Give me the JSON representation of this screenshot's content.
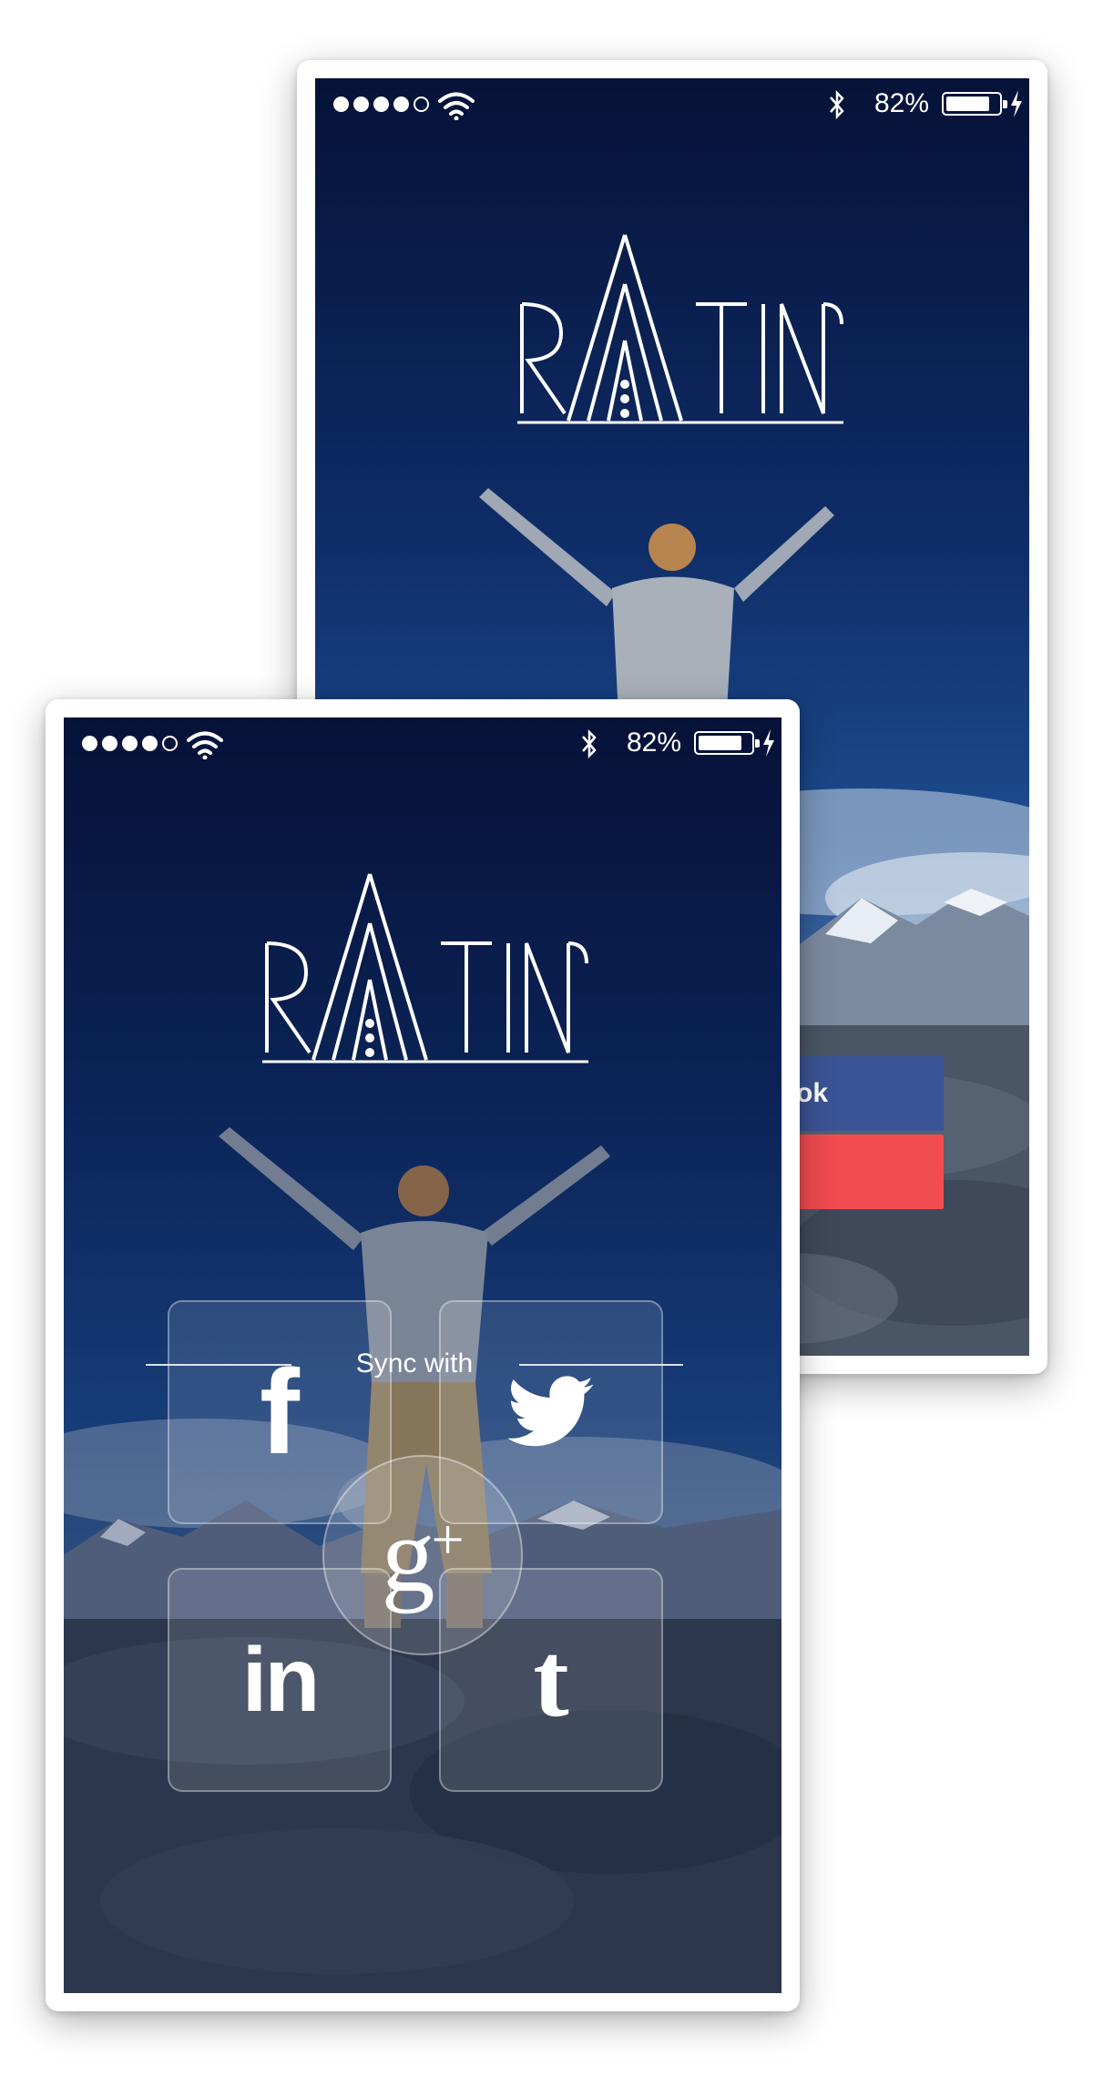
{
  "status_bar": {
    "signal_dots_filled": 4,
    "signal_dots_total": 5,
    "battery_text": "82%",
    "battery_level_pct": 82
  },
  "logo": {
    "text": "RATING"
  },
  "back_screen": {
    "buttons": [
      {
        "visible_label": "ok",
        "color": "#3b5495"
      },
      {
        "visible_label": "",
        "color": "#f24b50"
      }
    ]
  },
  "front_screen": {
    "sync_label": "Sync with",
    "social": [
      {
        "name": "facebook",
        "glyph": "f",
        "icon": "facebook-icon"
      },
      {
        "name": "twitter",
        "glyph": "",
        "icon": "twitter-bird-icon"
      },
      {
        "name": "google-plus",
        "glyph": "g",
        "glyph_plus": "+",
        "icon": "google-plus-icon"
      },
      {
        "name": "linkedin",
        "glyph": "in",
        "icon": "linkedin-icon"
      },
      {
        "name": "tumblr",
        "glyph": "t",
        "icon": "tumblr-icon"
      }
    ]
  },
  "colors": {
    "sky_top": "#061238",
    "sky_mid": "#123a7a",
    "facebook_blue": "#3b5495",
    "red_button": "#f24b50"
  }
}
